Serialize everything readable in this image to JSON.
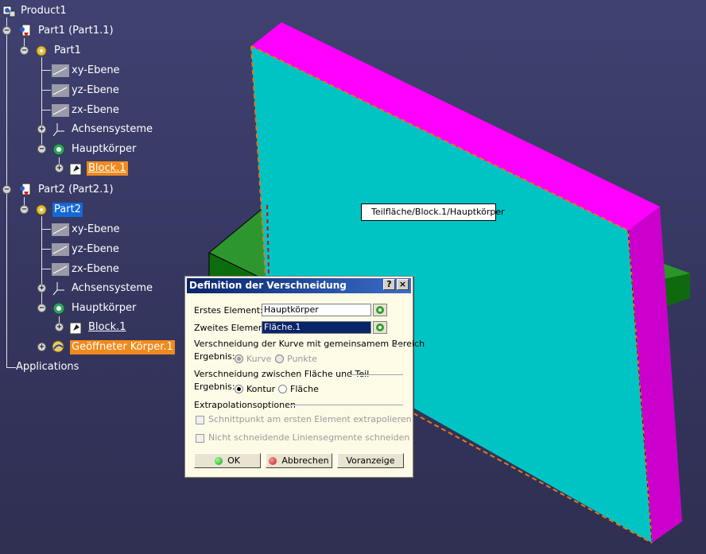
{
  "tree": {
    "root": "Product1",
    "part1_instance": "Part1 (Part1.1)",
    "part1": "Part1",
    "p1_xy": "xy-Ebene",
    "p1_yz": "yz-Ebene",
    "p1_zx": "zx-Ebene",
    "p1_axes": "Achsensysteme",
    "p1_body": "Hauptkörper",
    "p1_block": "Block.1",
    "part2_instance": "Part2 (Part2.1)",
    "part2": "Part2",
    "p2_xy": "xy-Ebene",
    "p2_yz": "yz-Ebene",
    "p2_zx": "zx-Ebene",
    "p2_axes": "Achsensysteme",
    "p2_body": "Hauptkörper",
    "p2_block": "Block.1",
    "p2_open_body": "Geöffneter Körper.1",
    "applications": "Applications"
  },
  "tooltip": "Teilfläche/Block.1/Hauptkörper",
  "dialog": {
    "title": "Definition der Verschneidung",
    "help": "?",
    "close": "×",
    "first_label": "Erstes Element:",
    "first_value": "Hauptkörper",
    "second_label": "Zweites Element:",
    "second_value": "Fläche.1",
    "section1": "Verschneidung der Kurve mit gemeinsamem Bereich",
    "result1_label": "Ergebnis:",
    "result1_opt1": "Kurve",
    "result1_opt2": "Punkte",
    "section2": "Verschneidung zwischen Fläche und Teil",
    "result2_label": "Ergebnis:",
    "result2_opt1": "Kontur",
    "result2_opt2": "Fläche",
    "section3": "Extrapolationsoptionen",
    "check1": "Schnittpunkt am ersten Element extrapolieren",
    "check2": "Nicht schneidende Liniensegmente schneiden",
    "ok": "OK",
    "cancel": "Abbrechen",
    "preview": "Voranzeige"
  },
  "colors": {
    "surface": "#00c8c8",
    "top_edge": "#ff00ff",
    "side_edge": "#cc00cc",
    "block": "#1f7f1f",
    "block_top": "#2fa02f",
    "selection_orange": "#f08a1c",
    "selection_blue": "#1468d8"
  }
}
